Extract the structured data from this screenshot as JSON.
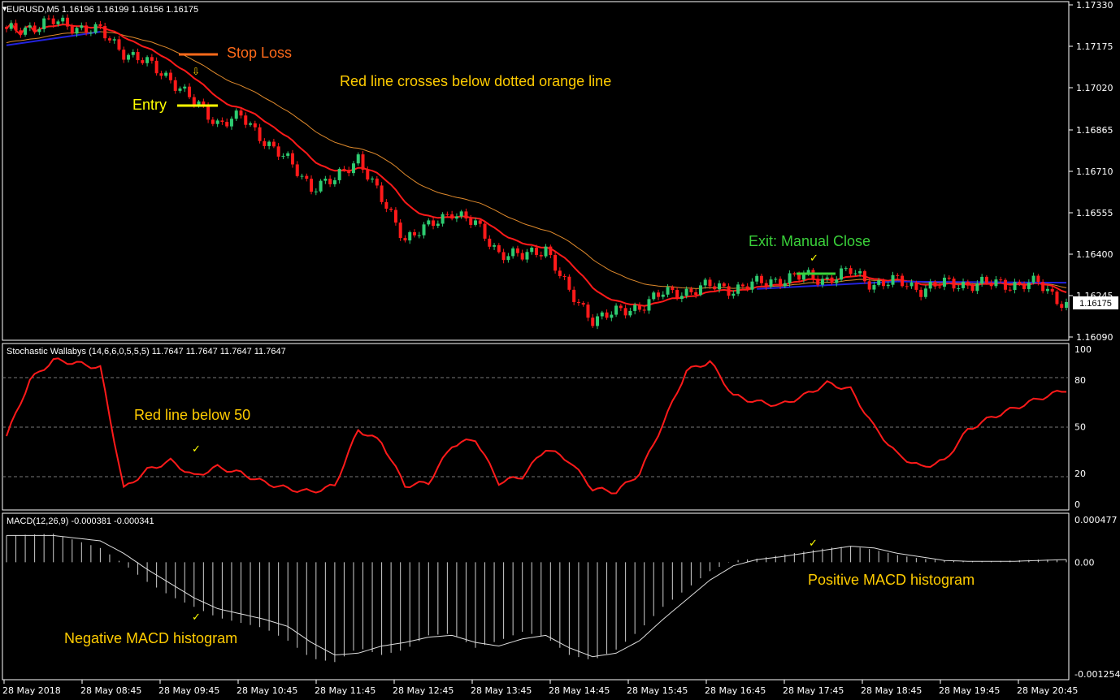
{
  "main": {
    "header": "EURUSD,M5  1.16196 1.16199 1.16156 1.16175",
    "price_ticks": [
      "1.17330",
      "1.17175",
      "1.17020",
      "1.16865",
      "1.16710",
      "1.16555",
      "1.16400",
      "1.16245",
      "1.16090"
    ],
    "current_price": "1.16175",
    "ylim": [
      1.1604,
      1.174
    ],
    "colors": {
      "bull": "#2ecc71",
      "bear": "#ff1a1a",
      "fast_ma": "#ff1a1a",
      "slow_ma": "#e08a2c",
      "trend_up": "#2222dd",
      "trend_down": "#dd2222"
    },
    "annotations": {
      "stop_loss": "Stop Loss",
      "cross": "Red line crosses below dotted orange line",
      "entry": "Entry",
      "exit": "Exit: Manual Close"
    }
  },
  "stoch": {
    "header": "Stochastic Wallabys (14,6,6,0,5,5,5) 11.7647 11.7647 11.7647 11.7647",
    "ticks": [
      "100",
      "80",
      "50",
      "20",
      "0"
    ],
    "levels": [
      80,
      50,
      20
    ],
    "annotation": "Red line below 50"
  },
  "macd": {
    "header": "MACD(12,26,9) -0.000381 -0.000341",
    "ticks": [
      "0.000477",
      "0.00",
      "-0.001254"
    ],
    "annotation_neg": "Negative MACD histogram",
    "annotation_pos": "Positive MACD histogram"
  },
  "time_labels": [
    "28 May 2018",
    "28 May 08:45",
    "28 May 09:45",
    "28 May 10:45",
    "28 May 11:45",
    "28 May 12:45",
    "28 May 13:45",
    "28 May 14:45",
    "28 May 15:45",
    "28 May 16:45",
    "28 May 17:45",
    "28 May 18:45",
    "28 May 19:45",
    "28 May 20:45"
  ],
  "chart_data": [
    {
      "type": "candlestick",
      "title": "EURUSD,M5",
      "ylim": [
        1.1604,
        1.174
      ],
      "series": [
        {
          "name": "close_approx",
          "x_index": [
            0,
            10,
            20,
            25,
            30,
            35,
            40,
            45,
            50,
            55,
            60,
            65,
            70,
            75,
            80,
            85,
            90,
            95,
            100,
            105,
            110,
            115,
            120,
            125,
            130,
            135,
            140,
            145,
            150,
            155,
            160,
            165,
            170,
            175,
            180,
            185,
            190,
            195,
            200,
            205,
            210,
            215,
            220,
            226
          ],
          "values": [
            1.1729,
            1.1733,
            1.1729,
            1.1721,
            1.1716,
            1.171,
            1.17,
            1.1692,
            1.1694,
            1.1685,
            1.1676,
            1.1666,
            1.1668,
            1.1678,
            1.166,
            1.1645,
            1.1649,
            1.1656,
            1.165,
            1.1639,
            1.1637,
            1.1641,
            1.1622,
            1.1612,
            1.1614,
            1.1617,
            1.1622,
            1.1623,
            1.1625,
            1.1624,
            1.1626,
            1.1628,
            1.1629,
            1.1628,
            1.1631,
            1.1626,
            1.1627,
            1.1624,
            1.1626,
            1.1626,
            1.1626,
            1.1626,
            1.1626,
            1.16175
          ]
        }
      ]
    },
    {
      "type": "line",
      "title": "Stochastic Wallabys (14,6,6,0,5,5,5)",
      "ylim": [
        0,
        100
      ],
      "series": [
        {
          "name": "stochastic",
          "x_index": [
            0,
            5,
            10,
            15,
            20,
            25,
            30,
            35,
            40,
            45,
            50,
            55,
            60,
            65,
            70,
            75,
            80,
            85,
            90,
            95,
            100,
            105,
            110,
            115,
            120,
            125,
            130,
            135,
            140,
            145,
            150,
            155,
            160,
            165,
            170,
            175,
            180,
            185,
            190,
            195,
            200,
            205,
            210,
            215,
            220,
            226
          ],
          "values": [
            44,
            80,
            93,
            91,
            88,
            10,
            22,
            28,
            18,
            24,
            20,
            14,
            10,
            8,
            12,
            48,
            40,
            12,
            14,
            38,
            42,
            14,
            18,
            36,
            28,
            10,
            8,
            20,
            52,
            86,
            92,
            70,
            66,
            64,
            70,
            78,
            74,
            50,
            32,
            24,
            28,
            48,
            56,
            62,
            68,
            74
          ]
        }
      ]
    },
    {
      "type": "bar",
      "title": "MACD(12,26,9)",
      "ylim": [
        -0.001254,
        0.000477
      ],
      "series": [
        {
          "name": "histogram",
          "x_index": [
            0,
            10,
            20,
            25,
            30,
            35,
            40,
            45,
            50,
            55,
            60,
            65,
            70,
            75,
            80,
            85,
            90,
            95,
            100,
            105,
            110,
            115,
            120,
            125,
            130,
            135,
            140,
            145,
            150,
            155,
            160,
            165,
            170,
            175,
            180,
            185,
            190,
            195,
            200,
            205,
            210,
            215,
            220,
            226
          ],
          "values": [
            0.0003,
            0.00032,
            0.00016,
            -2e-05,
            -0.00022,
            -0.00038,
            -0.0005,
            -0.00062,
            -0.00068,
            -0.00074,
            -0.00088,
            -0.00108,
            -0.00112,
            -0.00096,
            -0.00104,
            -0.00098,
            -0.00082,
            -0.0008,
            -0.00096,
            -0.00088,
            -0.00078,
            -0.00084,
            -0.00104,
            -0.0011,
            -0.00098,
            -0.00076,
            -0.0005,
            -0.0003,
            -0.0001,
            2e-05,
            4e-05,
            8e-05,
            0.00012,
            0.00016,
            0.00018,
            0.00014,
            8e-05,
            4e-05,
            2e-05,
            1e-05,
            1e-05,
            2e-05,
            3e-05,
            3e-05
          ]
        },
        {
          "name": "signal",
          "x_index": [
            0,
            10,
            20,
            25,
            30,
            35,
            40,
            45,
            50,
            55,
            60,
            65,
            70,
            75,
            80,
            85,
            90,
            95,
            100,
            105,
            110,
            115,
            120,
            125,
            130,
            135,
            140,
            145,
            150,
            155,
            160,
            165,
            170,
            175,
            180,
            185,
            190,
            195,
            200,
            205,
            210,
            215,
            220,
            226
          ],
          "values": [
            0.0003,
            0.0003,
            0.00024,
            0.0001,
            -8e-05,
            -0.00024,
            -0.0004,
            -0.00052,
            -0.00058,
            -0.00064,
            -0.00072,
            -0.0009,
            -0.00104,
            -0.00102,
            -0.00094,
            -0.0009,
            -0.00084,
            -0.00082,
            -0.0009,
            -0.00094,
            -0.00086,
            -0.00082,
            -0.00096,
            -0.00106,
            -0.00102,
            -0.00088,
            -0.00064,
            -0.00042,
            -0.0002,
            -4e-05,
            3e-05,
            6e-05,
            0.0001,
            0.00014,
            0.00018,
            0.00016,
            0.0001,
            6e-05,
            2e-05,
            1e-05,
            1e-05,
            1e-05,
            2e-05,
            3e-05
          ]
        }
      ]
    }
  ]
}
